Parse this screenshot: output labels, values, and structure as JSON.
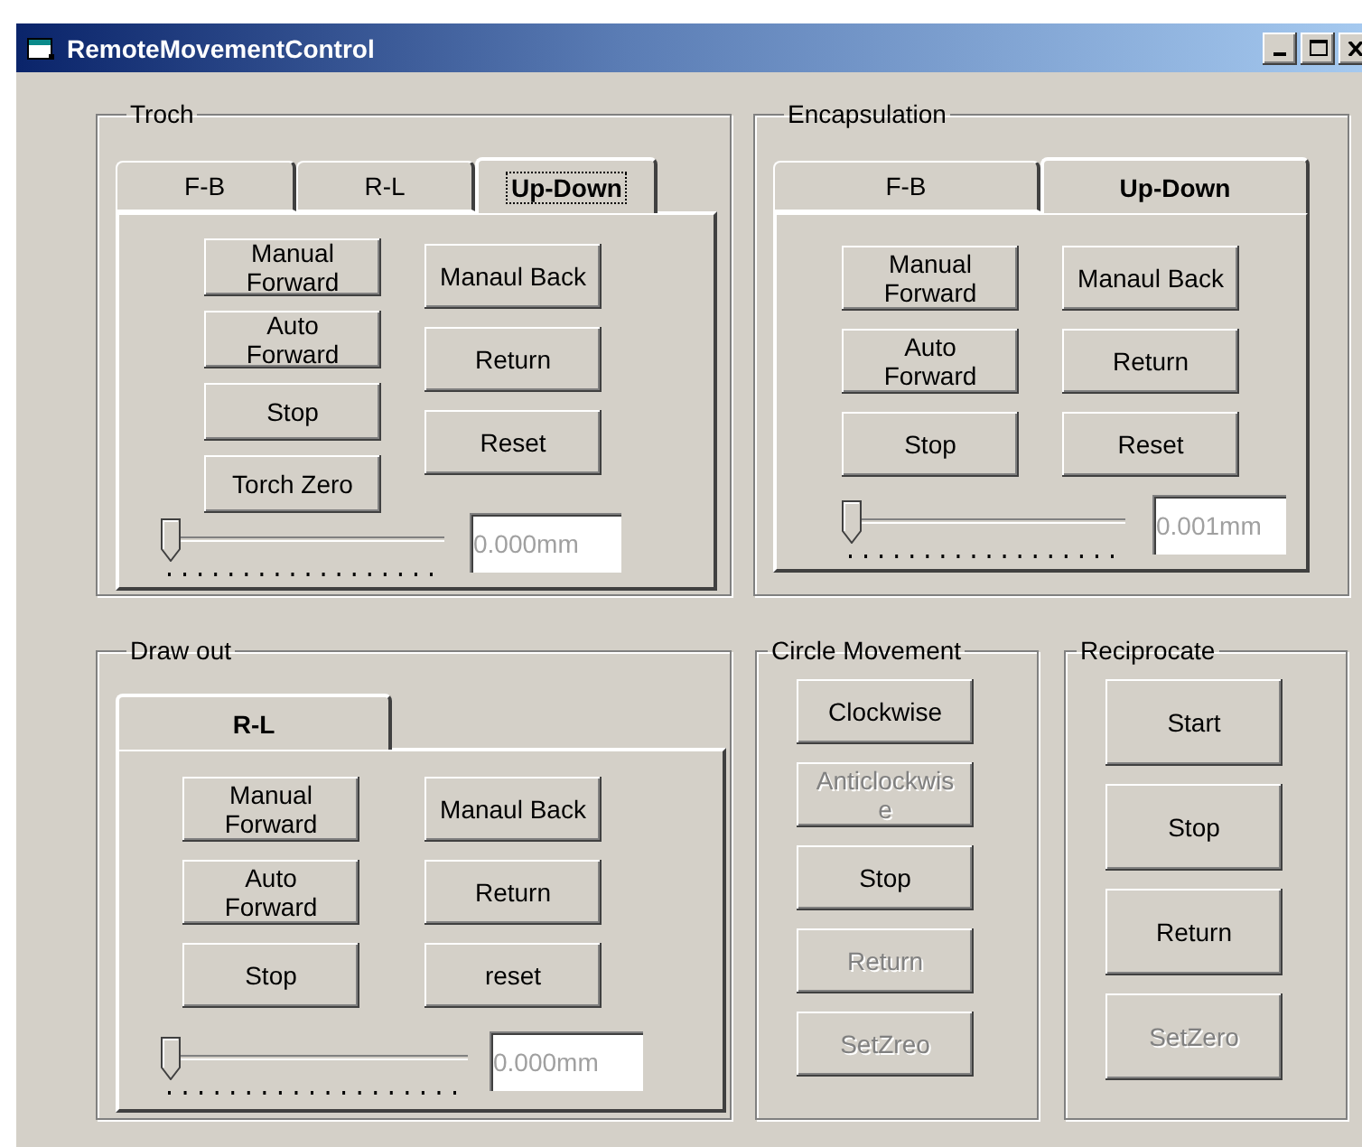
{
  "window": {
    "title": "RemoteMovementControl"
  },
  "groups": [
    {
      "kind": "tabs",
      "title": "Troch",
      "tabs": [
        {
          "label": "F-B",
          "selected": false,
          "focused": false
        },
        {
          "label": "R-L",
          "selected": false,
          "focused": false
        },
        {
          "label": "Up-Down",
          "selected": true,
          "focused": true
        }
      ],
      "left_column": [
        {
          "label": "Manual Forward",
          "disabled": false
        },
        {
          "label": "Auto Forward",
          "disabled": false
        },
        {
          "label": "Stop",
          "disabled": false
        },
        {
          "label": "Torch Zero",
          "disabled": false
        }
      ],
      "right_column": [
        {
          "label": "Manaul Back",
          "disabled": false
        },
        {
          "label": "Return",
          "disabled": false
        },
        {
          "label": "Reset",
          "disabled": false
        }
      ],
      "slider": {
        "level": 0
      },
      "field": {
        "value": "0.000mm",
        "disabled": true
      }
    },
    {
      "kind": "tabs",
      "title": "Encapsulation",
      "tabs": [
        {
          "label": "F-B",
          "selected": false,
          "focused": false
        },
        {
          "label": "Up-Down",
          "selected": true,
          "focused": false
        }
      ],
      "left_column": [
        {
          "label": "Manual Forward",
          "disabled": false
        },
        {
          "label": "Auto Forward",
          "disabled": false
        },
        {
          "label": "Stop",
          "disabled": false
        }
      ],
      "right_column": [
        {
          "label": "Manaul Back",
          "disabled": false
        },
        {
          "label": "Return",
          "disabled": false
        },
        {
          "label": "Reset",
          "disabled": false
        }
      ],
      "slider": {
        "level": 0
      },
      "field": {
        "value": "0.001mm",
        "disabled": true
      }
    },
    {
      "kind": "tabs",
      "title": "Draw out",
      "tabs": [
        {
          "label": "R-L",
          "selected": true,
          "focused": false
        }
      ],
      "left_column": [
        {
          "label": "Manual Forward",
          "disabled": false
        },
        {
          "label": "Auto Forward",
          "disabled": false
        },
        {
          "label": "Stop",
          "disabled": false
        }
      ],
      "right_column": [
        {
          "label": "Manaul Back",
          "disabled": false
        },
        {
          "label": "Return",
          "disabled": false
        },
        {
          "label": "reset",
          "disabled": false
        }
      ],
      "slider": {
        "level": 0
      },
      "field": {
        "value": "0.000mm",
        "disabled": true
      }
    },
    {
      "kind": "buttons",
      "title": "Circle Movement",
      "buttons": [
        {
          "label": "Clockwise",
          "disabled": false
        },
        {
          "label": "Anticlockwise",
          "disabled": true
        },
        {
          "label": "Stop",
          "disabled": false
        },
        {
          "label": "Return",
          "disabled": true
        },
        {
          "label": "SetZreo",
          "disabled": true
        }
      ]
    },
    {
      "kind": "buttons",
      "title": "Reciprocate",
      "buttons": [
        {
          "label": "Start",
          "disabled": false
        },
        {
          "label": "Stop",
          "disabled": false
        },
        {
          "label": "Return",
          "disabled": false
        },
        {
          "label": "SetZero",
          "disabled": true
        }
      ]
    }
  ]
}
